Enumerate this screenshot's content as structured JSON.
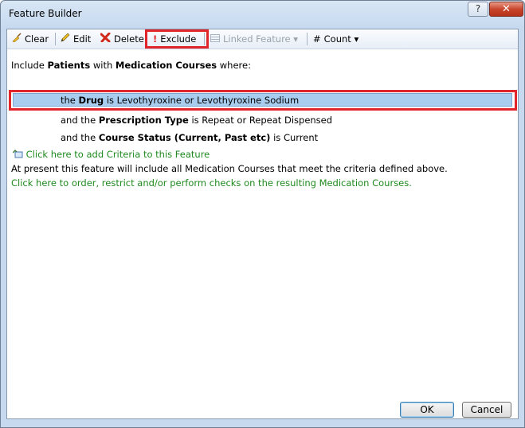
{
  "window": {
    "title": "Feature Builder",
    "help_glyph": "?",
    "close_glyph": "✕"
  },
  "toolbar": {
    "clear": "Clear",
    "edit": "Edit",
    "delete": "Delete",
    "exclude": "Exclude",
    "linked_feature": "Linked Feature",
    "count": "Count",
    "icons": {
      "clear": "broom-icon",
      "edit": "pencil-icon",
      "delete": "red-x-icon",
      "exclude": "exclamation-icon",
      "linked": "table-icon",
      "count": "hash-icon"
    }
  },
  "criteria": {
    "include": {
      "prefix": "Include",
      "entity": "Patients",
      "with": "with",
      "course": "Medication Courses",
      "where": "where:"
    },
    "drug": {
      "the": "the",
      "field": "Drug",
      "is": "is",
      "value": "Levothyroxine or Levothyroxine Sodium"
    },
    "prescription": {
      "and_the": "and the",
      "field": "Prescription Type",
      "is": "is",
      "value": "Repeat or Repeat Dispensed"
    },
    "course_status": {
      "and_the": "and the",
      "field": "Course Status (Current, Past etc)",
      "is": "is",
      "value": "Current"
    },
    "add_link": "Click here to add Criteria to this Feature",
    "info": "At present this feature will include all Medication Courses that meet the criteria defined above.",
    "order_link": "Click here to order, restrict and/or perform checks on the resulting Medication Courses."
  },
  "buttons": {
    "ok": "OK",
    "cancel": "Cancel"
  },
  "colors": {
    "highlight": "#e0262b",
    "selection": "#a9cdef",
    "link_green": "#1f8a1f"
  }
}
